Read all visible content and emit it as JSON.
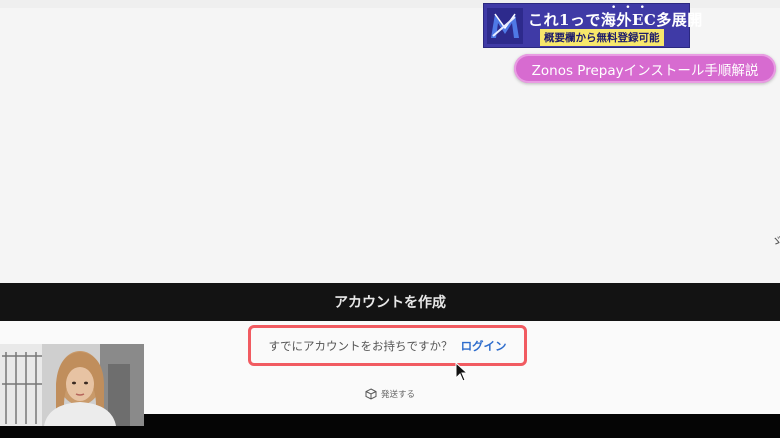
{
  "promo": {
    "line1": "これ1っで海外EC多展開",
    "dots": "•••",
    "line2": "概要欄から無料登録可能",
    "logo_letter": "M"
  },
  "topic_label": "Zonos Prepayインストール手順解説",
  "create_account_button": "アカウントを作成",
  "login_prompt": {
    "question": "すでにアカウントをお持ちですか？",
    "link": "ログイン"
  },
  "ship_label": "発送する",
  "right_glyph": "ゞ",
  "icons": {
    "logo": "m-logo-icon",
    "ship": "package-icon",
    "cursor": "mouse-cursor-icon"
  },
  "colors": {
    "banner_bg": "#3f3aa6",
    "banner_highlight": "#f7e76b",
    "pill_bg": "#d76bd0",
    "highlight_border": "#f15b61",
    "link": "#2d6ccc",
    "dark_bar": "#131313"
  }
}
